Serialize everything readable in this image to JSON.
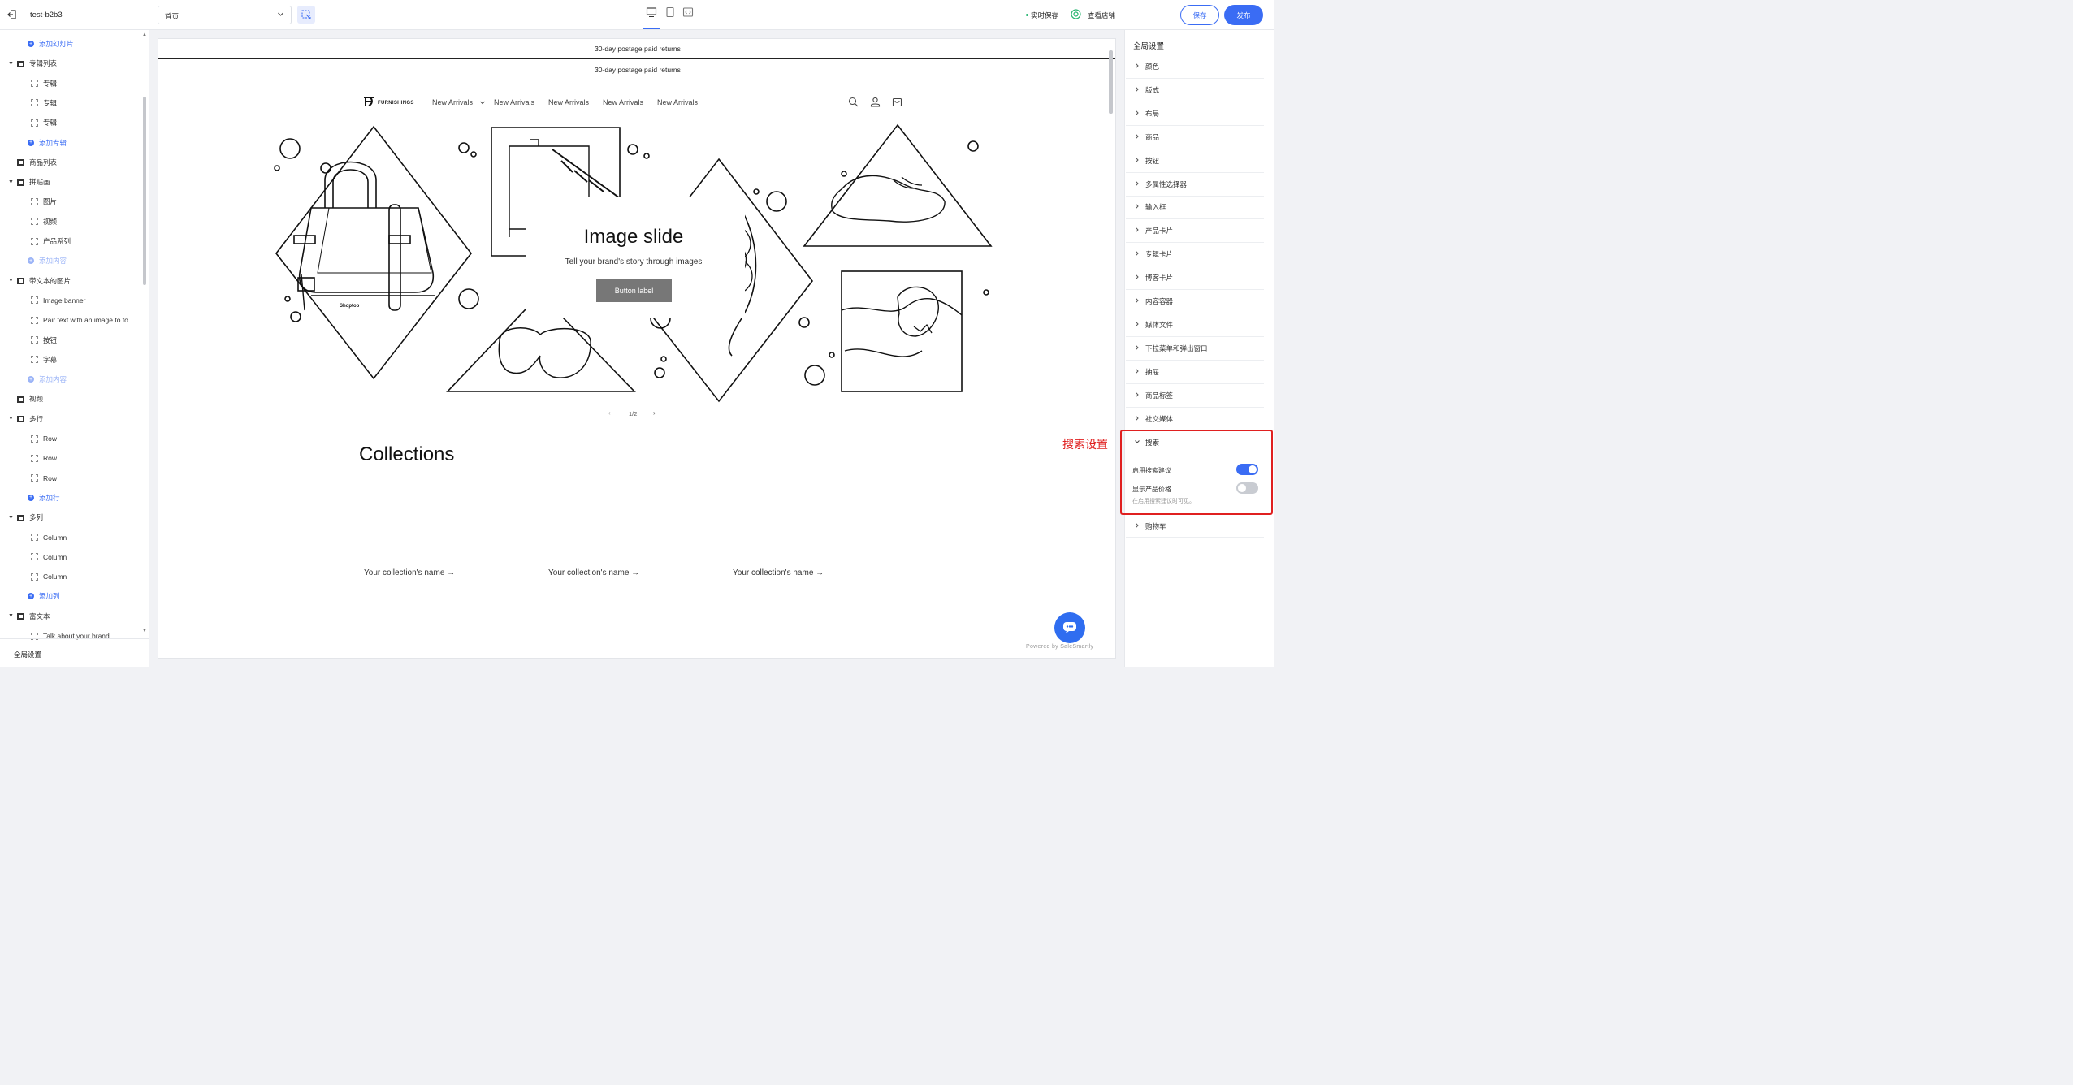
{
  "colors": {
    "accent": "#3a6cf4",
    "highlight": "#e02020"
  },
  "topbar": {
    "back_icon": "exit-icon",
    "store_name": "test-b2b3",
    "page_select": "首页",
    "autosave": "实时保存",
    "view_store": "查看店铺",
    "save": "保存",
    "publish": "发布"
  },
  "sidebar": {
    "items": [
      {
        "label": "添加幻灯片",
        "kind": "add"
      },
      {
        "label": "专辑列表",
        "kind": "section"
      },
      {
        "label": "专辑",
        "kind": "block"
      },
      {
        "label": "专辑",
        "kind": "block"
      },
      {
        "label": "专辑",
        "kind": "block"
      },
      {
        "label": "添加专辑",
        "kind": "add"
      },
      {
        "label": "商品列表",
        "kind": "section-nocaret"
      },
      {
        "label": "拼贴画",
        "kind": "section"
      },
      {
        "label": "图片",
        "kind": "block"
      },
      {
        "label": "视频",
        "kind": "block"
      },
      {
        "label": "产品系列",
        "kind": "block"
      },
      {
        "label": "添加内容",
        "kind": "add-muted"
      },
      {
        "label": "带文本的图片",
        "kind": "section"
      },
      {
        "label": "Image banner",
        "kind": "block"
      },
      {
        "label": "Pair text with an image to fo...",
        "kind": "block"
      },
      {
        "label": "按钮",
        "kind": "block"
      },
      {
        "label": "字幕",
        "kind": "block"
      },
      {
        "label": "添加内容",
        "kind": "add-muted"
      },
      {
        "label": "视频",
        "kind": "section-nocaret"
      },
      {
        "label": "多行",
        "kind": "section"
      },
      {
        "label": "Row",
        "kind": "block"
      },
      {
        "label": "Row",
        "kind": "block"
      },
      {
        "label": "Row",
        "kind": "block"
      },
      {
        "label": "添加行",
        "kind": "add"
      },
      {
        "label": "多列",
        "kind": "section"
      },
      {
        "label": "Column",
        "kind": "block"
      },
      {
        "label": "Column",
        "kind": "block"
      },
      {
        "label": "Column",
        "kind": "block"
      },
      {
        "label": "添加列",
        "kind": "add"
      },
      {
        "label": "富文本",
        "kind": "section"
      },
      {
        "label": "Talk about your brand",
        "kind": "block"
      }
    ],
    "footer": "全局设置"
  },
  "preview": {
    "announcement_1": "30-day postage paid returns",
    "announcement_2": "30-day postage paid returns",
    "logo_text": "FURNISHINGS",
    "nav": [
      "New Arrivals",
      "New Arrivals",
      "New Arrivals",
      "New Arrivals",
      "New Arrivals"
    ],
    "slide_title": "Image slide",
    "slide_subtitle": "Tell your brand's story through images",
    "slide_button": "Button label",
    "bag_brand": "Shoptop",
    "pager": "1/2",
    "collections_title": "Collections",
    "collection_names": [
      "Your collection's name →",
      "Your collection's name →",
      "Your collection's name →"
    ],
    "powered_by": "Powered by SaleSmartly"
  },
  "annotation": {
    "label": "搜索设置"
  },
  "settings": {
    "title": "全局设置",
    "items": [
      "颜色",
      "版式",
      "布局",
      "商品",
      "按钮",
      "多属性选择器",
      "输入框",
      "产品卡片",
      "专辑卡片",
      "博客卡片",
      "内容容器",
      "媒体文件",
      "下拉菜单和弹出窗口",
      "抽屉",
      "商品标签",
      "社交媒体"
    ],
    "search": {
      "label": "搜索",
      "enable_suggestions": "启用搜索建议",
      "enable_suggestions_on": true,
      "show_price": "显示产品价格",
      "show_price_on": false,
      "hint": "在启用搜索建议时可见。"
    },
    "cart": "购物车"
  }
}
